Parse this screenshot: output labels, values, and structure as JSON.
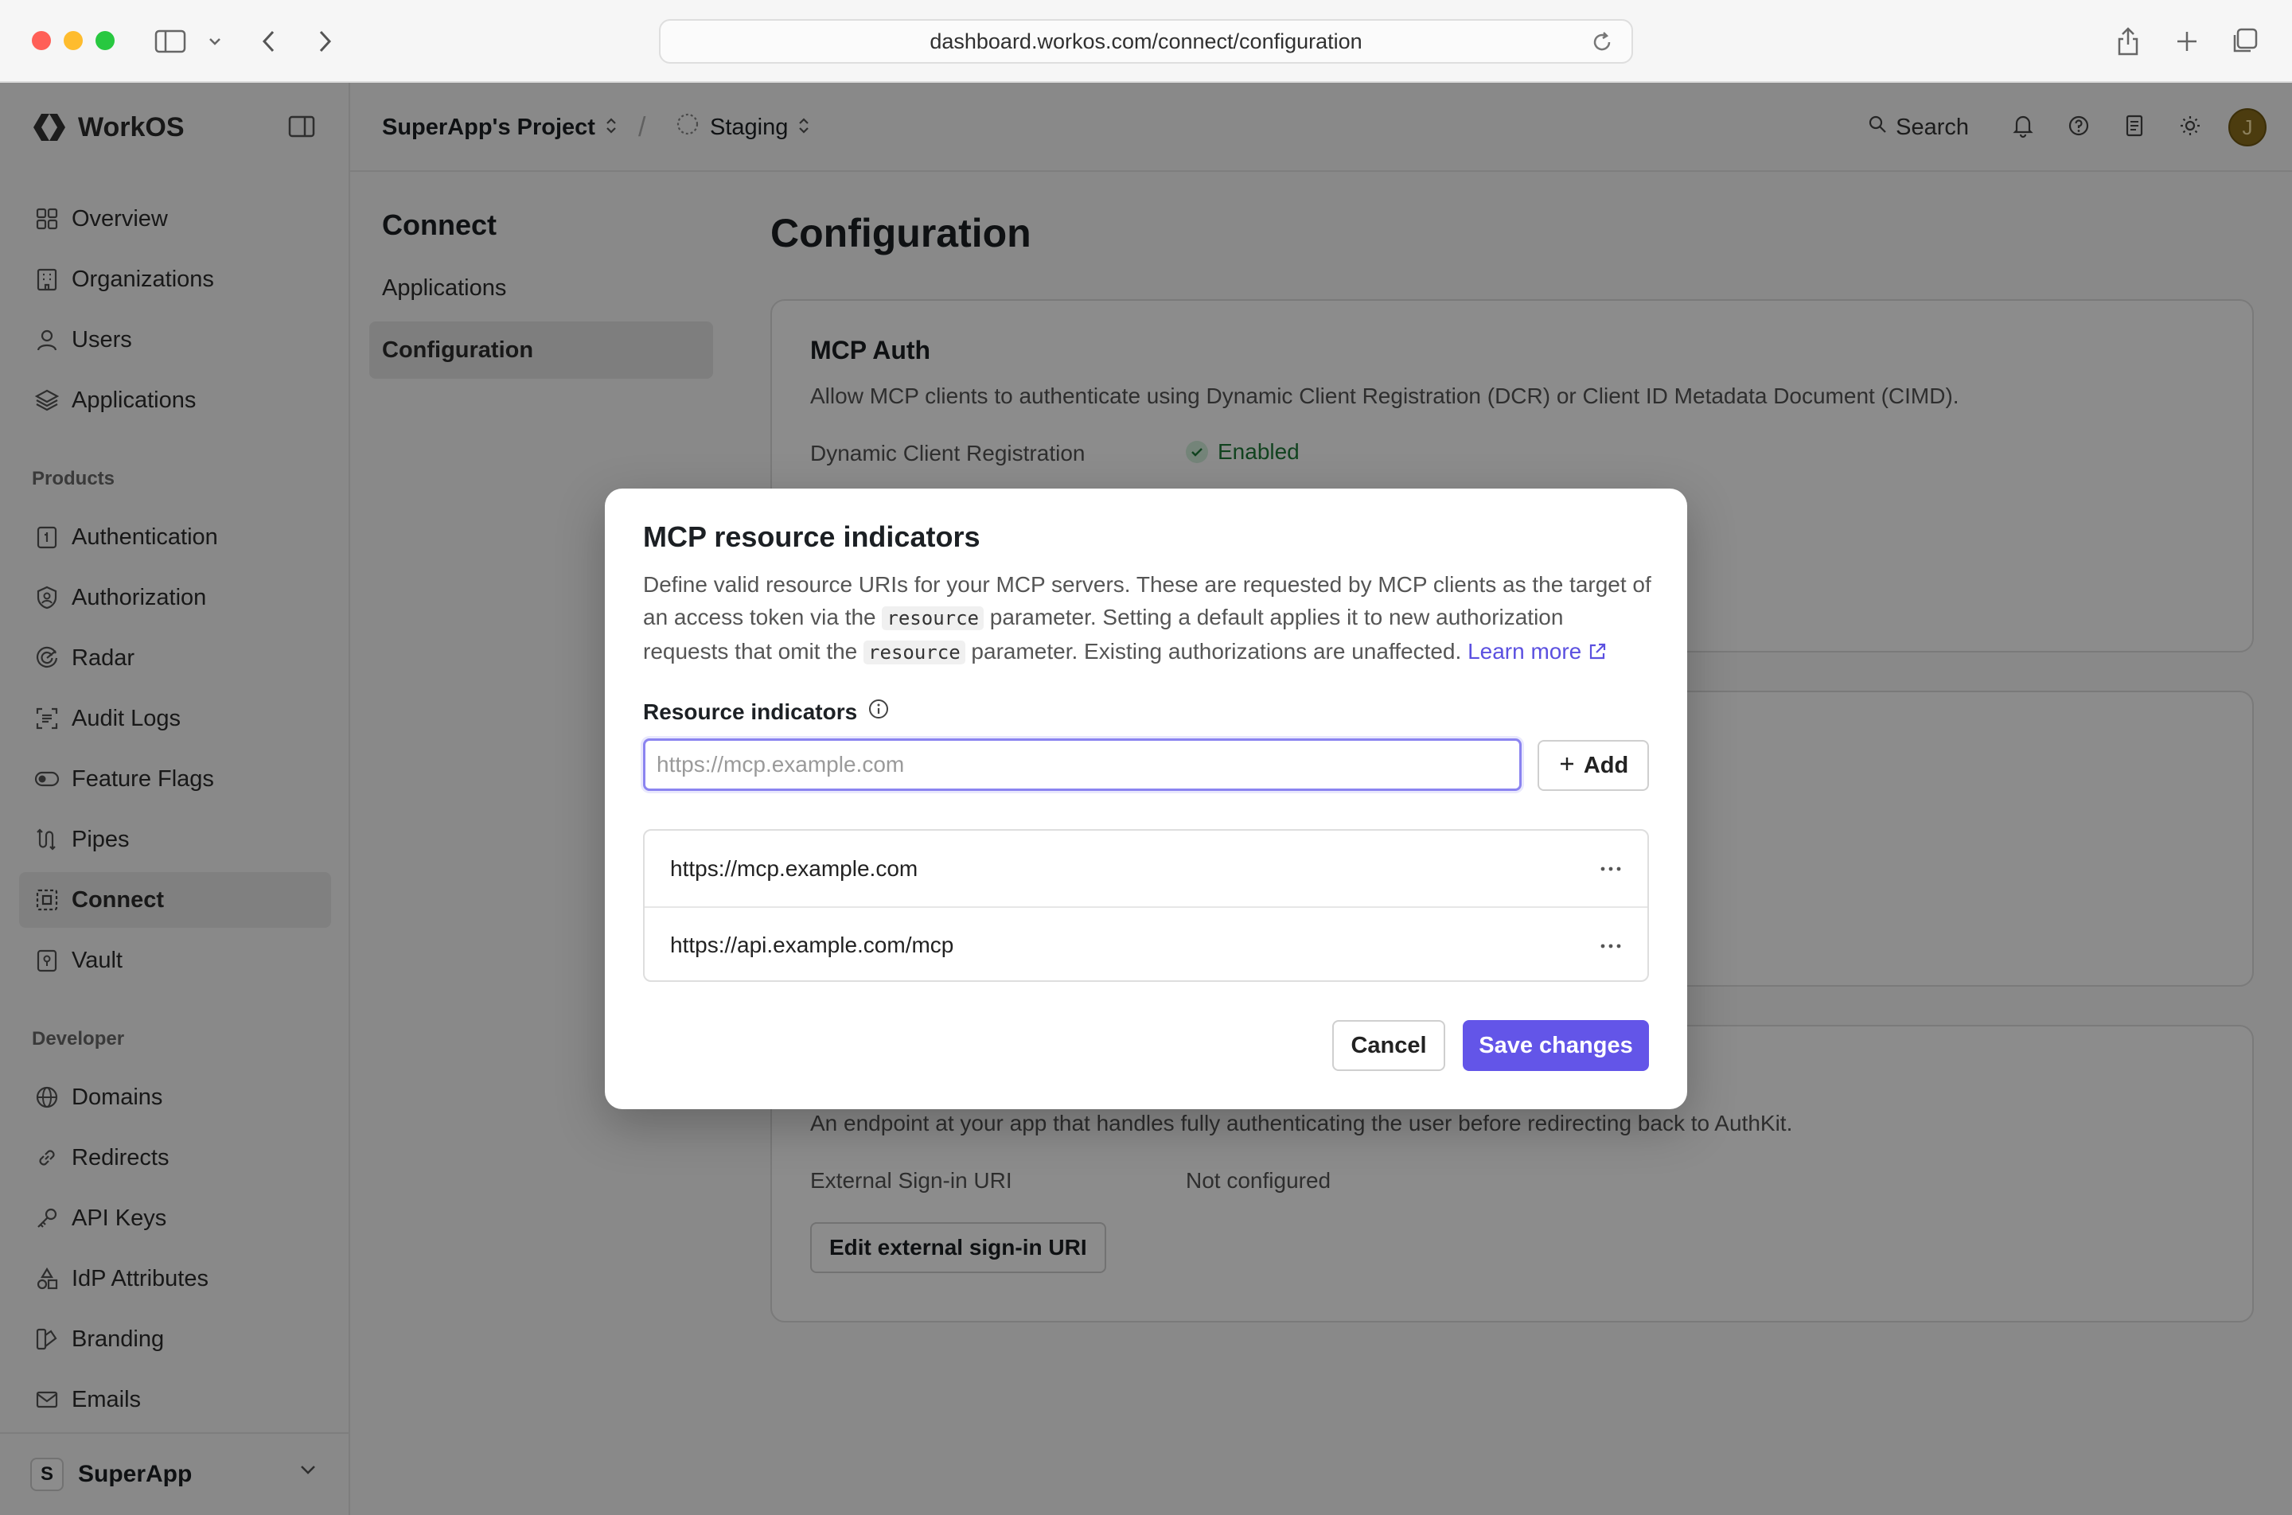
{
  "browser": {
    "url": "dashboard.workos.com/connect/configuration"
  },
  "brand": {
    "name": "WorkOS"
  },
  "sidebar": {
    "items": [
      {
        "label": "Overview",
        "icon": "grid-icon"
      },
      {
        "label": "Organizations",
        "icon": "building-icon"
      },
      {
        "label": "Users",
        "icon": "user-icon"
      },
      {
        "label": "Applications",
        "icon": "layers-icon"
      }
    ],
    "products_heading": "Products",
    "products": [
      {
        "label": "Authentication",
        "icon": "key-card-icon"
      },
      {
        "label": "Authorization",
        "icon": "shield-user-icon"
      },
      {
        "label": "Radar",
        "icon": "radar-icon"
      },
      {
        "label": "Audit Logs",
        "icon": "scan-list-icon"
      },
      {
        "label": "Feature Flags",
        "icon": "toggle-icon"
      },
      {
        "label": "Pipes",
        "icon": "pipe-icon"
      },
      {
        "label": "Connect",
        "icon": "connect-icon"
      },
      {
        "label": "Vault",
        "icon": "vault-icon"
      }
    ],
    "developer_heading": "Developer",
    "developer": [
      {
        "label": "Domains",
        "icon": "globe-icon"
      },
      {
        "label": "Redirects",
        "icon": "link-icon"
      },
      {
        "label": "API Keys",
        "icon": "key-icon"
      },
      {
        "label": "IdP Attributes",
        "icon": "shapes-icon"
      },
      {
        "label": "Branding",
        "icon": "brush-icon"
      },
      {
        "label": "Emails",
        "icon": "mail-icon"
      }
    ],
    "workspace": {
      "initial": "S",
      "name": "SuperApp"
    }
  },
  "topbar": {
    "project": "SuperApp's Project",
    "separator": "/",
    "environment": "Staging",
    "search_label": "Search",
    "avatar_initial": "J"
  },
  "subnav": {
    "title": "Connect",
    "items": [
      "Applications",
      "Configuration"
    ]
  },
  "main": {
    "title": "Configuration",
    "mcp_card": {
      "title": "MCP Auth",
      "description": "Allow MCP clients to authenticate using Dynamic Client Registration (DCR) or Client ID Metadata Document (CIMD).",
      "dcr_label": "Dynamic Client Registration",
      "dcr_value": "Enabled"
    },
    "signin_card": {
      "description": "An endpoint at your app that handles fully authenticating the user before redirecting back to AuthKit.",
      "uri_label": "External Sign-in URI",
      "uri_value": "Not configured",
      "edit_button": "Edit external sign-in URI"
    }
  },
  "modal": {
    "title": "MCP resource indicators",
    "desc_1": "Define valid resource URIs for your MCP servers. These are requested by MCP clients as the target of an access token via the ",
    "code": "resource",
    "desc_2": " parameter. Setting a default applies it to new authorization requests that omit the ",
    "desc_3": " parameter. Existing authorizations are unaffected. ",
    "learn_more": "Learn more",
    "field_label": "Resource indicators",
    "input_placeholder": "https://mcp.example.com",
    "input_value": "",
    "add_button": "Add",
    "indicators": [
      "https://mcp.example.com",
      "https://api.example.com/mcp"
    ],
    "cancel_button": "Cancel",
    "save_button": "Save changes"
  },
  "colors": {
    "accent": "#6355e8",
    "link": "#5b50e0",
    "success": "#1f7a3a",
    "overlay": "rgba(0,0,0,0.45)"
  }
}
